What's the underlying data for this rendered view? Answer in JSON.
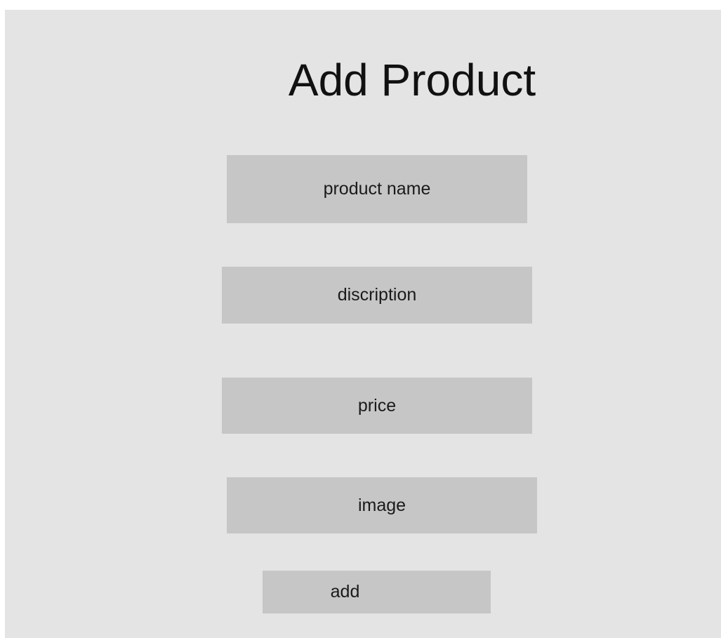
{
  "page": {
    "title": "Add Product"
  },
  "form": {
    "product_name": {
      "placeholder": "product name",
      "value": ""
    },
    "description": {
      "placeholder": "discription",
      "value": ""
    },
    "price": {
      "placeholder": "price",
      "value": ""
    },
    "image": {
      "placeholder": "image",
      "value": ""
    },
    "add_label": "add"
  },
  "colors": {
    "background": "#e4e4e4",
    "field": "#c6c6c6",
    "text": "#111111"
  }
}
